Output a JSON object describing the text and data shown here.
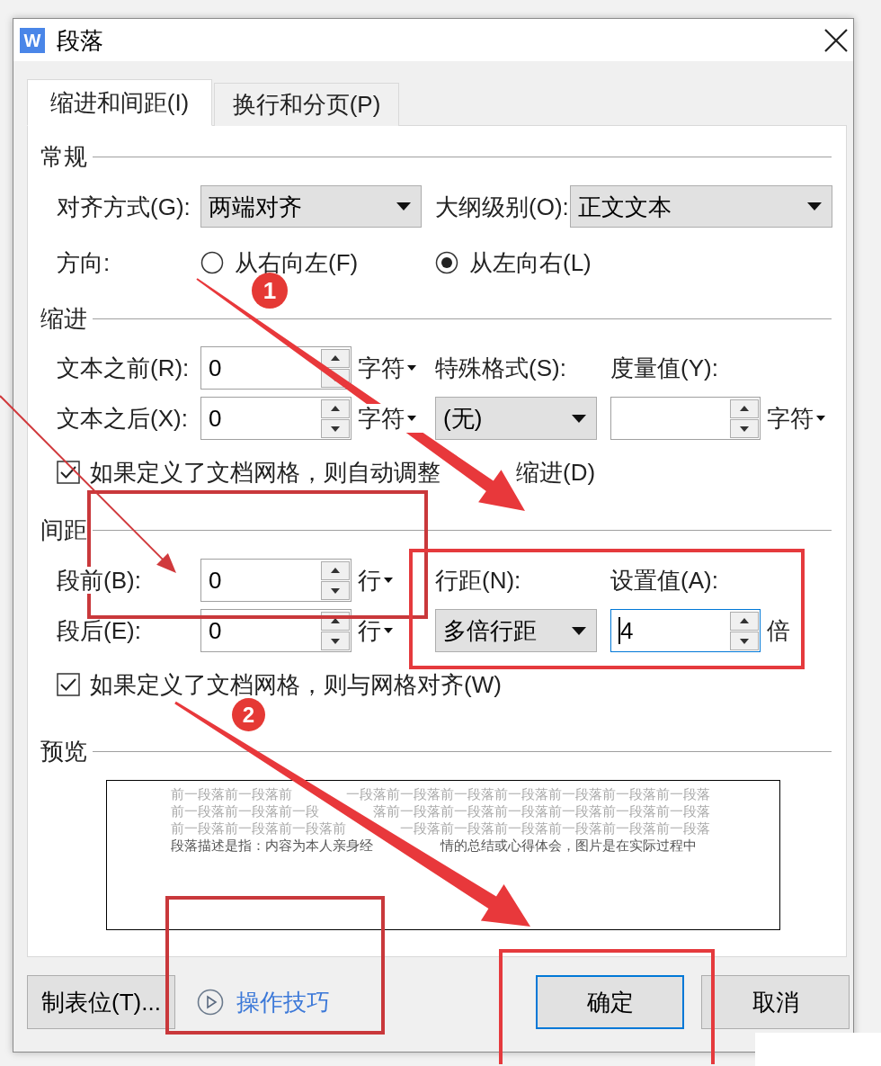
{
  "window": {
    "app_icon_letter": "W",
    "title": "段落"
  },
  "tabs": [
    {
      "label": "缩进和间距(I)",
      "selected": true
    },
    {
      "label": "换行和分页(P)",
      "selected": false
    }
  ],
  "general": {
    "heading": "常规",
    "alignment": {
      "label": "对齐方式(G):",
      "value": "两端对齐"
    },
    "outline_level": {
      "label": "大纲级别(O):",
      "value": "正文文本"
    },
    "direction": {
      "label": "方向:",
      "options": [
        {
          "label": "从右向左(F)",
          "selected": false
        },
        {
          "label": "从左向右(L)",
          "selected": true
        }
      ]
    }
  },
  "indent": {
    "heading": "缩进",
    "before_text": {
      "label": "文本之前(R):",
      "value": "0",
      "unit": "字符"
    },
    "after_text": {
      "label": "文本之后(X):",
      "value": "0",
      "unit": "字符"
    },
    "special_format": {
      "label": "特殊格式(S):",
      "value": "(无)"
    },
    "measure": {
      "label": "度量值(Y):",
      "unit": "字符"
    },
    "grid_option": {
      "label_parts": [
        "如果定义了文档网格，则自动调整",
        "缩进(D)"
      ],
      "checked": true
    }
  },
  "spacing": {
    "heading": "间距",
    "before": {
      "label": "段前(B):",
      "value": "0",
      "unit": "行"
    },
    "after": {
      "label": "段后(E):",
      "value": "0",
      "unit": "行"
    },
    "line_spacing": {
      "label": "行距(N):",
      "value": "多倍行距"
    },
    "setting": {
      "label": "设置值(A):",
      "value": "4",
      "suffix": "倍",
      "focused": true
    },
    "grid_option": {
      "label": "如果定义了文档网格，则与网格对齐(W)",
      "checked": true
    }
  },
  "preview": {
    "heading": "预览",
    "lines": [
      {
        "kind": "previous",
        "parts": [
          "前一段落前一段落前",
          "一段落前一段落前一段落前一段落前一段落前一段落前一段落"
        ]
      },
      {
        "kind": "previous",
        "parts": [
          "前一段落前一段落前一段",
          "落前一段落前一段落前一段落前一段落前一段落前一段落"
        ]
      },
      {
        "kind": "previous",
        "parts": [
          "前一段落前一段落前一段落前",
          "一段落前一段落前一段落前一段落前一段落前一段落"
        ]
      },
      {
        "kind": "current",
        "parts": [
          "段落描述是指：内容为本人亲身经",
          "情的总结或心得体会，图片是在实际过程中"
        ]
      }
    ]
  },
  "footer": {
    "tabs_button": "制表位(T)...",
    "tips_link": "操作技巧",
    "ok_button": "确定",
    "cancel_button": "取消"
  },
  "annotations": {
    "badges": [
      {
        "text": "1"
      },
      {
        "text": "2"
      }
    ]
  }
}
